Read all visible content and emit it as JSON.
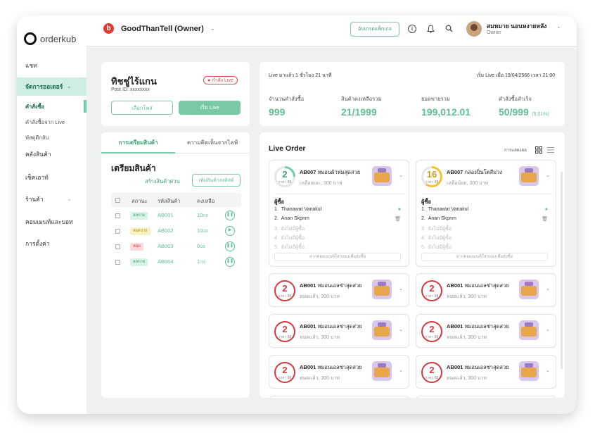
{
  "sidebar": {
    "logo_text": "orderkub",
    "items": [
      {
        "label": "แชท"
      },
      {
        "label": "จัดการออเดอร์"
      },
      {
        "label": "คลังสินค้า"
      },
      {
        "label": "เช็คเอาท์"
      },
      {
        "label": "ร้านค้า"
      },
      {
        "label": "คอมเมนท์และบอท"
      },
      {
        "label": "การตั้งค่า"
      }
    ],
    "subitems": [
      {
        "label": "คำสั่งซื้อ"
      },
      {
        "label": "คำสั่งซื้อจาก Live"
      },
      {
        "label": "พัสดุตีกลับ"
      }
    ]
  },
  "header": {
    "brand_name": "GoodThanTell (Owner)",
    "upgrade_label": "อัปเกรดแพ็กเกจ",
    "user_name": "สมหมาย นอนหงายหลัง",
    "user_role": "Owner"
  },
  "post": {
    "title": "ทิชชู่ไร้แกน",
    "post_id": "Post ID: xxxxxxxx",
    "live_badge": "กำลัง Live",
    "select_post_label": "เลือกโพส",
    "start_live_label": "เริ่ม Live"
  },
  "stats": {
    "live_duration": "Live มาแล้ว 1 ชั่วโมง 21 นาที",
    "live_started": "เริ่ม Live เมื่อ 19/04/2566 เวลา 21:00",
    "items": [
      {
        "label": "จำนวนคำสั่งซื้อ",
        "value": "999",
        "extra": ""
      },
      {
        "label": "สินค้าคงเหลือรวม",
        "value": "21/1999",
        "extra": ""
      },
      {
        "label": "ยอดขายรวม",
        "value": "199,012.01",
        "extra": ""
      },
      {
        "label": "คำสั่งซื้อสำเร็จ",
        "value": "50/999",
        "extra": "(5.01%)"
      }
    ]
  },
  "prep": {
    "tabs": [
      {
        "label": "การเตรียมสินค้า"
      },
      {
        "label": "ความคิดเห็นจากไลฟ์"
      }
    ],
    "heading": "เตรียมสินค้า",
    "create_quick": "สร้างสินค้าด่วน",
    "add_to_list": "เพิ่มสินค้าลงลิสต์",
    "columns": [
      "สถานะ",
      "รหัสสินค้า",
      "คงเหลือ"
    ],
    "rows": [
      {
        "status": "ลดขาย",
        "status_color": "#d9f3e6",
        "status_text": "#3a9c72",
        "code": "AB001",
        "remain": "10",
        "total": "/10",
        "action": "❚❚"
      },
      {
        "status": "หยุดขาย",
        "status_color": "#fbf1c4",
        "status_text": "#b08a10",
        "code": "AB002",
        "remain": "10",
        "total": "/20",
        "action": "▶"
      },
      {
        "status": "หมด",
        "status_color": "#fbd9dc",
        "status_text": "#d4383e",
        "code": "AB003",
        "remain": "0",
        "total": "/20",
        "action": "❚❚"
      },
      {
        "status": "ลดขาย",
        "status_color": "#d9f3e6",
        "status_text": "#3a9c72",
        "code": "AB004",
        "remain": "1",
        "total": "/10",
        "action": "❚❚"
      }
    ]
  },
  "live_order": {
    "title": "Live Order",
    "view_label": "การแสดงผล",
    "big_cards": [
      {
        "count": "2",
        "price": "ราคา 88",
        "ring_color": "#6fcfa4",
        "ring_pct": 0.25,
        "code": "AB007",
        "name": "หมอนผ้าห่มสุดสวย",
        "detail": "เหลือเยอะ, 300 บาท",
        "buyers": [
          "Thanawat Vanakul",
          "Anan Skpnm",
          "ยังไม่มีผู้ซื้อ",
          "ยังไม่มีผู้ซื้อ",
          "ยังไม่มีผู้ซื้อ"
        ]
      },
      {
        "count": "16",
        "price": "ราคา 88",
        "ring_color": "#f2c230",
        "ring_pct": 0.6,
        "code": "AB007",
        "name": "กล่องปิ่นโตสีม่วง",
        "detail": "เหลือน้อย, 300 บาท",
        "buyers": [
          "Thanawat Vanakul",
          "Anan Skpnm",
          "ยังไม่มีผู้ซื้อ",
          "ยังไม่มีผู้ซื้อ",
          "ยังไม่มีผู้ซื้อ"
        ]
      }
    ],
    "buyers_heading": "ผู้ซื้อ",
    "comment_hint": "ลากคอมเมนท์ใส่กล่องเพื่อสั่งซื้อ",
    "small_card": {
      "count": "2",
      "price": "ราคา 88",
      "code": "AB001",
      "name": "หมอนเอลซ่าสุดสวย",
      "detail": "หมดแล้ว, 300 บาท"
    }
  },
  "colors": {
    "accent": "#79c9a6",
    "danger": "#d4383e",
    "warning": "#f2c230"
  }
}
